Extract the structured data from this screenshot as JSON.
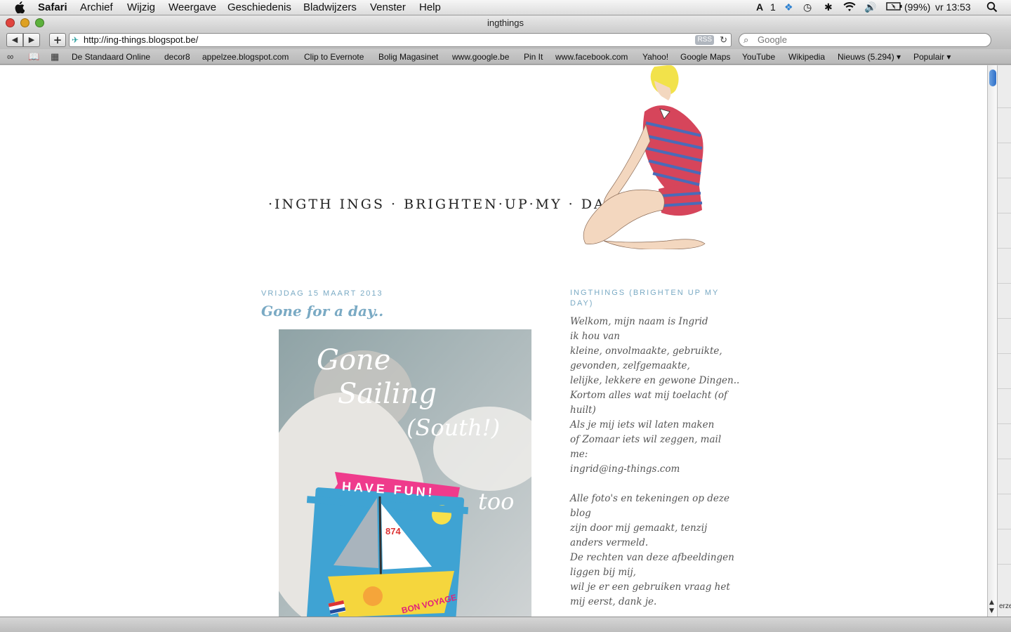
{
  "menubar": {
    "apple": "",
    "app_name": "Safari",
    "menus": [
      "Archief",
      "Wijzig",
      "Weergave",
      "Geschiedenis",
      "Bladwijzers",
      "Venster",
      "Help"
    ],
    "status": {
      "adobe_count": "1",
      "battery": "(99%)",
      "clock": "vr 13:53"
    }
  },
  "window": {
    "title": "ingthings"
  },
  "toolbar": {
    "back": "◀",
    "forward": "▶",
    "add": "+",
    "url": "http://ing-things.blogspot.be/",
    "rss": "RSS",
    "search_placeholder": "Google"
  },
  "bookmarks": [
    "De Standaard Online",
    "decor8",
    "appelzee.blogspot.com",
    "Clip to Evernote",
    "Bolig Magasinet",
    "www.google.be",
    "Pin It",
    "www.facebook.com",
    "Yahoo!",
    "Google Maps",
    "YouTube",
    "Wikipedia",
    "Nieuws (5.294) ▾",
    "Populair ▾"
  ],
  "blog": {
    "title": "·INGTH INGS · BRIGHTEN·UP·MY · DAY·",
    "post": {
      "date": "vrijdag 15 maart 2013",
      "title": "Gone for a day..",
      "photo_lines": [
        "Gone",
        "Sailing",
        "(South!)"
      ],
      "photo_badge": "HAVE FUN!",
      "photo_too": "too",
      "photo_boat_number": "874",
      "photo_boat_text": "BON VOYAGE"
    },
    "sidebar": {
      "title": "INGTHINGS (BRIGHTEN UP MY DAY)",
      "lines": [
        "Welkom, mijn naam is Ingrid",
        "ik hou van",
        "kleine, onvolmaakte, gebruikte,",
        "gevonden, zelfgemaakte,",
        "lelijke, lekkere en gewone Dingen..",
        "Kortom alles wat mij toelacht (of",
        "huilt)",
        "Als je mij iets wil laten maken",
        "of Zomaar iets wil zeggen, mail",
        "me:",
        "ingrid@ing-things.com",
        "",
        "Alle foto's en tekeningen op deze",
        "blog",
        "zijn door mij gemaakt, tenzij",
        "anders vermeld.",
        "De rechten van deze afbeeldingen",
        "liggen bij mij,",
        "wil je er een gebruiken vraag het",
        "mij eerst, dank je."
      ]
    }
  },
  "right_sliver_text": "erze"
}
